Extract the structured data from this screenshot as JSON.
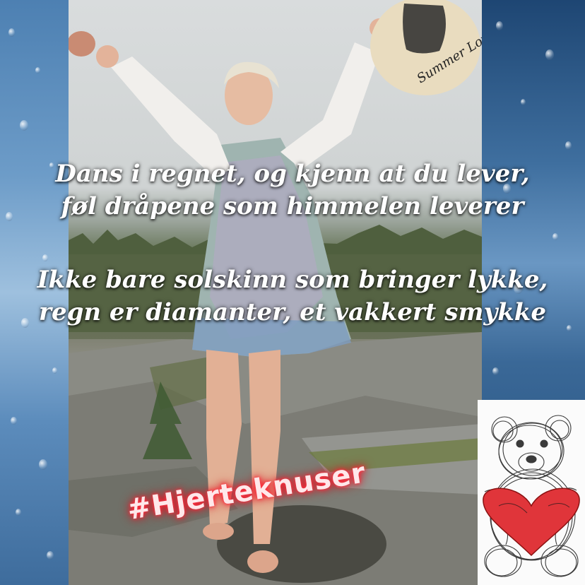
{
  "poem": {
    "line1": "Dans i regnet, og kjenn at du lever,",
    "line2": "føl dråpene som himmelen leverer",
    "line3": "Ikke bare solskinn som bringer lykke,",
    "line4": "regn er diamanter, et vakkert smykke"
  },
  "hat_text": "Summer Loving",
  "hashtag": "#Hjerteknuser",
  "colors": {
    "text": "#ffffff",
    "hashtag_glow": "#ff2030",
    "rain_blue": "#3d6f9e",
    "heart_red": "#e0353a"
  },
  "icons": [
    "rain-drops",
    "teddy-bear-sketch",
    "red-heart"
  ]
}
